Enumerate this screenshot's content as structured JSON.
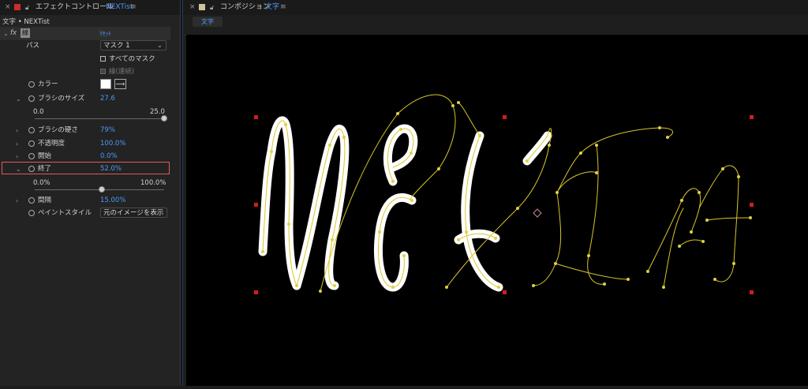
{
  "effect_panel": {
    "close": "×",
    "title": "エフェクトコントロール",
    "layer": "NEXTist",
    "menu": "≡",
    "breadcrumb": "文字 • NEXTist",
    "effect_name": "線",
    "reset": "ﾘｾｯﾄ",
    "fx": "fx",
    "path_label": "パス",
    "path_value": "マスク 1",
    "all_masks": "すべてのマスク",
    "stroke_seq": "線(連続)",
    "color_label": "カラー",
    "brush_size_label": "ブラシのサイズ",
    "brush_size_value": "27.6",
    "brush_size_min": "0.0",
    "brush_size_max": "25.0",
    "brush_size_fraction": 1.0,
    "hardness_label": "ブラシの硬さ",
    "hardness_value": "79%",
    "opacity_label": "不透明度",
    "opacity_value": "100.0%",
    "start_label": "開始",
    "start_value": "0.0%",
    "end_label": "終了",
    "end_value": "52.0%",
    "end_min": "0.0%",
    "end_max": "100.0%",
    "end_fraction": 0.52,
    "spacing_label": "間隔",
    "spacing_value": "15.00%",
    "paint_style_label": "ペイントスタイル",
    "paint_style_value": "元のイメージを表示"
  },
  "comp_panel": {
    "close": "×",
    "title": "コンポジション",
    "comp_name": "文字",
    "menu": "≡",
    "tab_label": "文字",
    "text_label": "NEXTist"
  },
  "colors": {
    "accent": "#4b9af5",
    "highlight": "#e05a5a",
    "path": "#d8c62a",
    "stroke": "#ffffff",
    "handle": "#d11d1d"
  }
}
